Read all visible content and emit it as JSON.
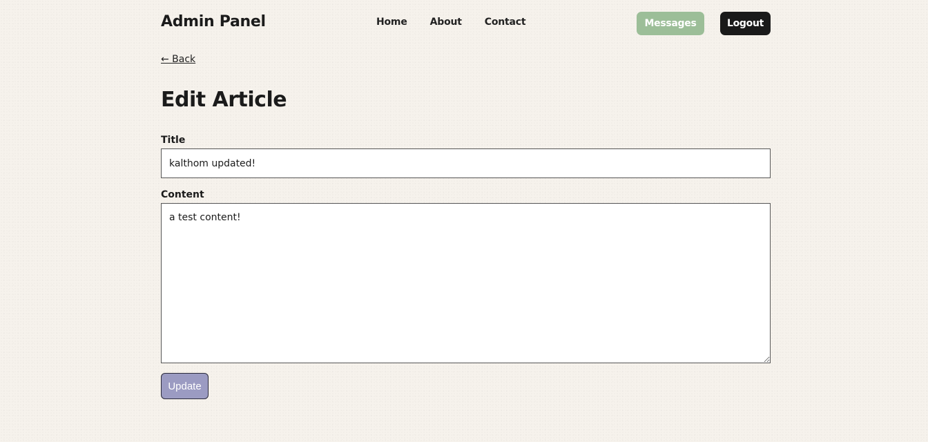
{
  "header": {
    "brand": "Admin Panel",
    "nav": [
      {
        "label": "Home"
      },
      {
        "label": "About"
      },
      {
        "label": "Contact"
      }
    ],
    "messages_label": "Messages",
    "logout_label": "Logout"
  },
  "back_link": "← Back",
  "page_title": "Edit Article",
  "form": {
    "title_label": "Title",
    "title_value": "kalthom updated!",
    "content_label": "Content",
    "content_value": "a test content!",
    "submit_label": "Update"
  },
  "colors": {
    "background": "#f6f2ec",
    "messages_button": "#9cbe98",
    "logout_button": "#1a1a1a",
    "update_button": "#9b9bc2"
  }
}
